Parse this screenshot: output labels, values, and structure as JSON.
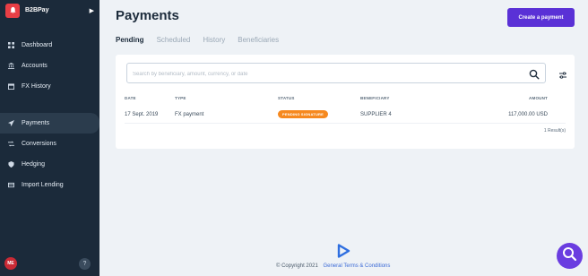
{
  "sidebar": {
    "brand": {
      "name": "B2BPay",
      "logo_icon": "bell-icon"
    },
    "items": [
      {
        "label": "Dashboard",
        "icon": "grid-icon"
      },
      {
        "label": "Accounts",
        "icon": "bank-icon"
      },
      {
        "label": "FX History",
        "icon": "calendar-icon"
      },
      {
        "label": "Payments",
        "icon": "send-icon",
        "active": true
      },
      {
        "label": "Conversions",
        "icon": "exchange-icon"
      },
      {
        "label": "Hedging",
        "icon": "shield-icon"
      },
      {
        "label": "Import Lending",
        "icon": "card-icon"
      }
    ],
    "avatar_initials": "ME",
    "help_label": "?"
  },
  "header": {
    "title": "Payments",
    "create_button": "Create a payment"
  },
  "tabs": [
    {
      "label": "Pending",
      "active": true
    },
    {
      "label": "Scheduled"
    },
    {
      "label": "History"
    },
    {
      "label": "Beneficiaries"
    }
  ],
  "search": {
    "placeholder": "Search by beneficiary, amount, currency, or date"
  },
  "table": {
    "columns": [
      "DATE",
      "TYPE",
      "STATUS",
      "BENEFICIARY",
      "AMOUNT"
    ],
    "rows": [
      {
        "date": "17 Sept. 2019",
        "type": "FX payment",
        "status": "PENDING SIGNATURE",
        "beneficiary": "SUPPLIER 4",
        "amount": "117,000.00 USD"
      }
    ],
    "results": "1 Result(s)"
  },
  "footer": {
    "copyright": "© Copyright 2021",
    "terms_link": "General Terms & Conditions"
  },
  "colors": {
    "sidebar_bg": "#1b2a3a",
    "accent": "#5a31d6",
    "status_pending": "#f6891f",
    "brand_red": "#e83e45"
  }
}
